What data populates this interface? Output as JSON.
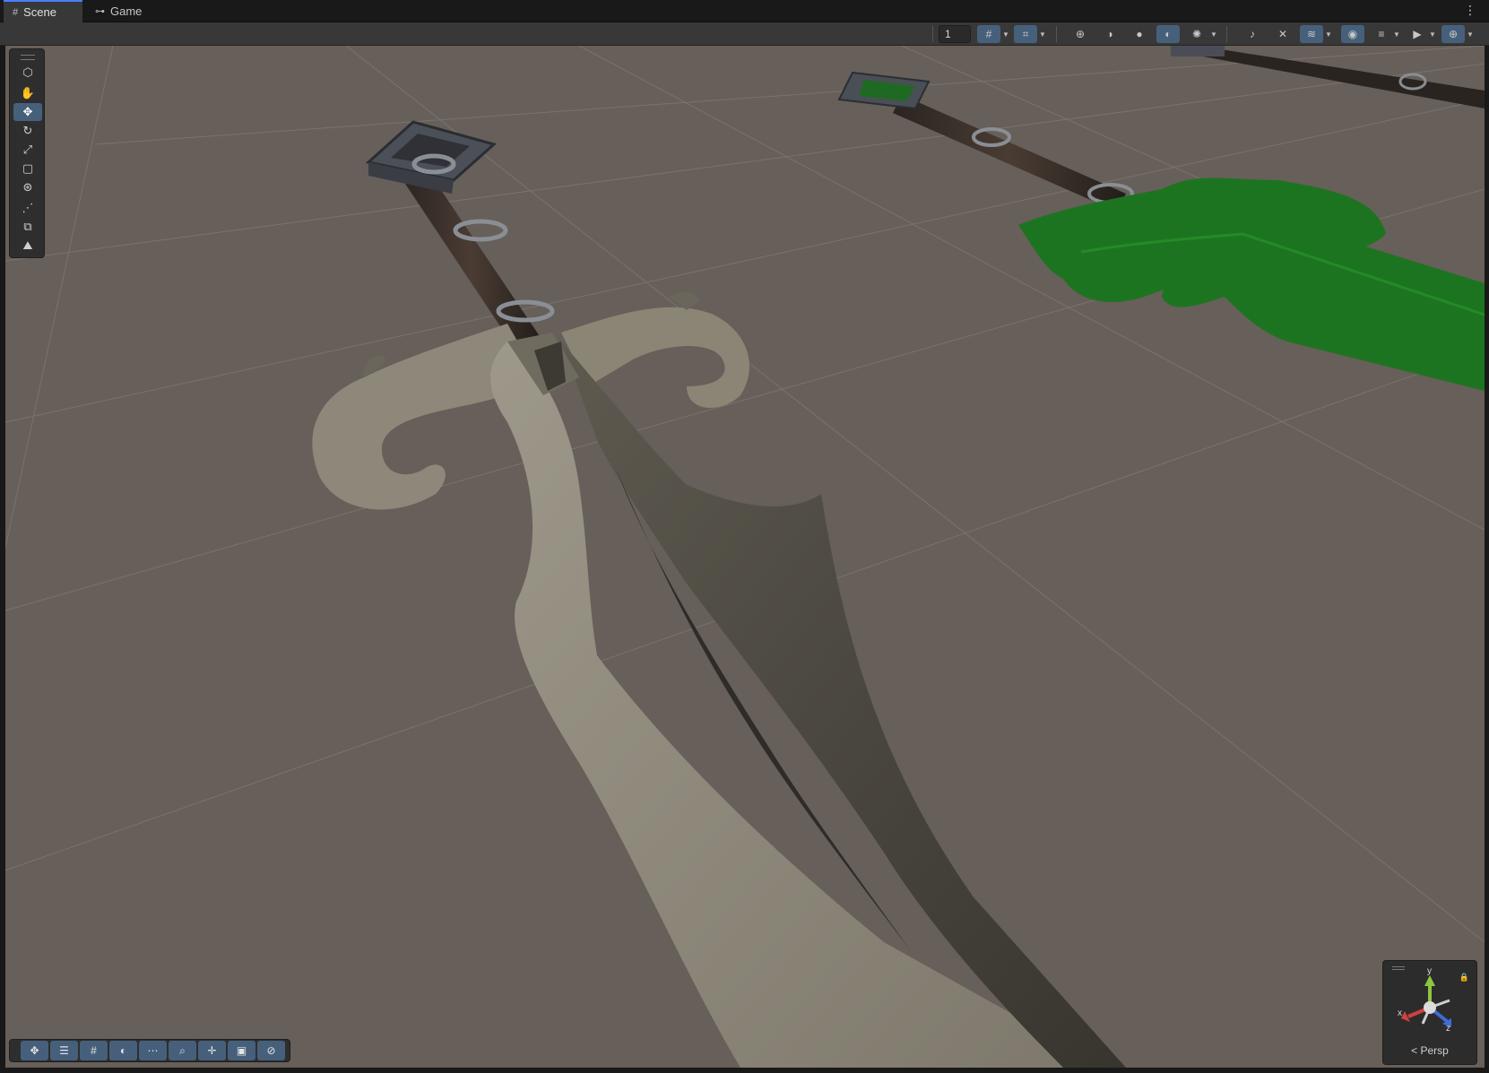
{
  "tabs": [
    {
      "label": "Scene",
      "icon": "grid-icon",
      "active": true
    },
    {
      "label": "Game",
      "icon": "gamepad-icon",
      "active": false
    }
  ],
  "toolbar": {
    "layer_value": "1",
    "buttons": [
      "grid-snap-icon",
      "increment-snap-icon",
      "wireframe-shading-icon",
      "shaded-wireframe-icon",
      "shaded-icon",
      "rendered-shading-icon",
      "lighting-icon",
      "audio-off-icon",
      "effects-off-icon",
      "draw-mode-icon",
      "visibility-icon",
      "layers-icon",
      "camera-icon",
      "gizmos-icon"
    ]
  },
  "tools": [
    "view-cube-icon",
    "hand-icon",
    "move-icon",
    "rotate-icon",
    "scale-icon",
    "rect-icon",
    "transform-icon",
    "custom-tool-icon",
    "box-icon",
    "terrain-icon"
  ],
  "overlay_buttons": [
    "move-icon",
    "settings-icon",
    "grid-icon",
    "shading-icon",
    "snap-icon",
    "search-icon",
    "pivot-icon",
    "camera-icon",
    "compass-icon"
  ],
  "gizmo": {
    "label": "Persp",
    "axes": {
      "x": "x",
      "y": "y",
      "z": "z"
    }
  },
  "colors": {
    "accent": "#4c7dff",
    "active_button": "#46607c",
    "viewport_bg": "#675f59",
    "blade": "#8c887a",
    "green_blade": "#1f7a22"
  }
}
